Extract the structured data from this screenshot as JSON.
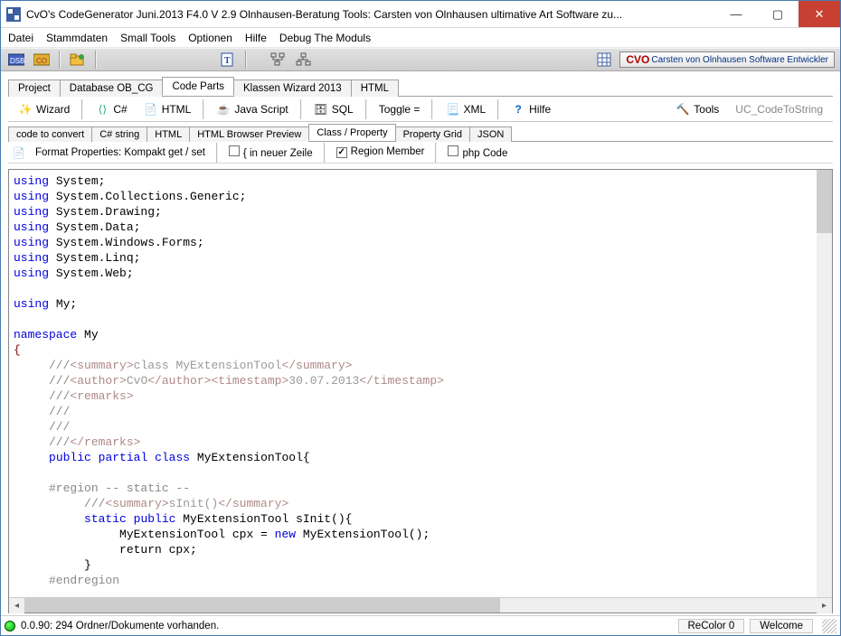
{
  "window": {
    "title": "CvO's CodeGenerator Juni.2013 F4.0 V 2.9 Olnhausen-Beratung Tools: Carsten von Olnhausen ultimative Art Software zu..."
  },
  "menu": [
    "Datei",
    "Stammdaten",
    "Small Tools",
    "Optionen",
    "Hilfe",
    "Debug The Moduls"
  ],
  "brand_text_bold": "CVO",
  "brand_text": "Carsten von Olnhausen Software Entwickler",
  "tabs_main": {
    "items": [
      "Project",
      "Database OB_CG",
      "Code Parts",
      "Klassen Wizard 2013",
      "HTML"
    ],
    "active": 2
  },
  "toolbar_buttons": {
    "wizard": "Wizard",
    "csharp": "C#",
    "html": "HTML",
    "js": "Java Script",
    "sql": "SQL",
    "toggle": "Toggle =",
    "xml": "XML",
    "hilfe": "Hilfe",
    "tools": "Tools",
    "uc": "UC_CodeToString"
  },
  "subtabs": {
    "items": [
      "code to convert",
      "C# string",
      "HTML",
      "HTML Browser Preview",
      "Class / Property",
      "Property Grid",
      "JSON"
    ],
    "active": 4
  },
  "optrow": {
    "format_label": "Format Properties: Kompakt get / set",
    "chk_neuer": "{ in neuer Zeile",
    "chk_region": "Region Member",
    "chk_php": "php Code",
    "checked_neuer": false,
    "checked_region": true,
    "checked_php": false
  },
  "statusbar": {
    "main": "0.0.90: 294 Ordner/Dokumente vorhanden.",
    "recolor": "ReColor 0",
    "welcome": "Welcome"
  },
  "code": {
    "l1a": "using",
    "l1b": " System;",
    "l2a": "using",
    "l2b": " System.Collections.Generic;",
    "l3a": "using",
    "l3b": " System.Drawing;",
    "l4a": "using",
    "l4b": " System.Data;",
    "l5a": "using",
    "l5b": " System.Windows.Forms;",
    "l6a": "using",
    "l6b": " System.Linq;",
    "l7a": "using",
    "l7b": " System.Web;",
    "l9a": "using",
    "l9b": " My;",
    "l11a": "namespace",
    "l11b": " My",
    "brace": "{",
    "c1a": "     ///",
    "c1b": "<summary>",
    "c1c": "class MyExtensionTool",
    "c1d": "</summary>",
    "c2a": "     ///",
    "c2b": "<author>",
    "c2c": "CvO",
    "c2d": "</author>",
    "c2e": "<timestamp>",
    "c2f": "30.07.2013",
    "c2g": "</timestamp>",
    "c3a": "     ///",
    "c3b": "<remarks>",
    "c4": "     ///",
    "c5": "     ///",
    "c6a": "     ///",
    "c6b": "</remarks>",
    "pc1": "     ",
    "pc_public": "public",
    "pc_sp": " ",
    "pc_partial": "partial",
    "pc_sp2": " ",
    "pc_class": "class",
    "pc_rest": " MyExtensionTool{",
    "rg1": "     #region -- static --",
    "si1a": "          ///",
    "si1b": "<summary>",
    "si1c": "sInit()",
    "si1d": "</summary>",
    "si2a": "          ",
    "si2_static": "static",
    "si2_sp": " ",
    "si2_public": "public",
    "si2_rest": " MyExtensionTool sInit(){",
    "si3a": "               MyExtensionTool cpx = ",
    "si3_new": "new",
    "si3b": " MyExtensionTool();",
    "si4": "               return cpx;",
    "si5": "          }",
    "rg2": "     #endregion"
  }
}
